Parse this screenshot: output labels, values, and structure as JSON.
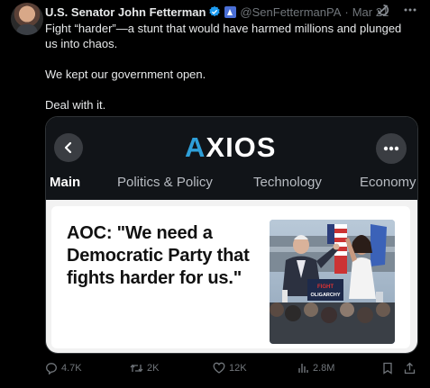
{
  "tweet": {
    "author_name": "U.S. Senator John Fetterman",
    "handle": "@SenFettermanPA",
    "separator": "·",
    "date": "Mar 21",
    "lines": [
      "Fight “harder”—a stunt that would have harmed millions and plunged us into chaos.",
      "We kept our government open.",
      "Deal with it."
    ]
  },
  "card": {
    "logo_text": "AXIOS",
    "tabs": [
      "Main",
      "Politics & Policy",
      "Technology",
      "Economy"
    ],
    "active_tab": "Main",
    "headline": "AOC: \"We need a Democratic Party that fights harder for us.\"",
    "photo_sign_text": "FIGHT OLIGARCHY"
  },
  "metrics": {
    "replies": "4.7K",
    "reposts": "2K",
    "likes": "12K",
    "views": "2.8M"
  },
  "colors": {
    "background": "#000000",
    "text": "#e7e9ea",
    "muted": "#71767b",
    "verified": "#1d9bf0",
    "axios_accent": "#2e9fd8"
  }
}
